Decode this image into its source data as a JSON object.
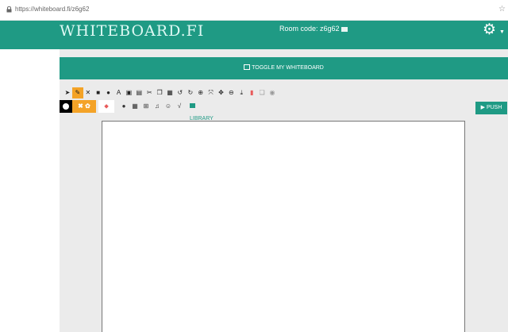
{
  "browser": {
    "url": "https://whiteboard.fi/z6g62"
  },
  "header": {
    "logo_text": "WHITEBOARD.FI",
    "room_label": "Room code: z6g62"
  },
  "toolbar": {
    "toggle_label": "TOGGLE MY WHITEBOARD",
    "push_label": "PUSH",
    "library_label": "LIBRARY",
    "row1_icons": [
      {
        "name": "pointer-icon",
        "glyph": "➤"
      },
      {
        "name": "pencil-icon",
        "glyph": "✎"
      },
      {
        "name": "line-tool-icon",
        "glyph": "✕"
      },
      {
        "name": "rectangle-icon",
        "glyph": "■"
      },
      {
        "name": "circle-icon",
        "glyph": "●"
      },
      {
        "name": "text-icon",
        "glyph": "A"
      },
      {
        "name": "image-icon",
        "glyph": "▣"
      },
      {
        "name": "document-icon",
        "glyph": "▤"
      },
      {
        "name": "cut-icon",
        "glyph": "✂"
      },
      {
        "name": "copy-icon",
        "glyph": "❐"
      },
      {
        "name": "paste-icon",
        "glyph": "▦"
      },
      {
        "name": "undo-icon",
        "glyph": "↺"
      },
      {
        "name": "redo-icon",
        "glyph": "↻"
      },
      {
        "name": "zoom-icon",
        "glyph": "⊕"
      },
      {
        "name": "fit-icon",
        "glyph": "⤧"
      },
      {
        "name": "move-icon",
        "glyph": "✥"
      },
      {
        "name": "zoom-out-icon",
        "glyph": "⊖"
      },
      {
        "name": "download-icon",
        "glyph": "⤓"
      },
      {
        "name": "delete-icon",
        "glyph": "▮"
      },
      {
        "name": "layer-icon",
        "glyph": "❏"
      },
      {
        "name": "eye-icon",
        "glyph": "◉"
      }
    ],
    "row2_icons": [
      {
        "name": "bucket-icon",
        "glyph": "●"
      },
      {
        "name": "grid-icon",
        "glyph": "▦"
      },
      {
        "name": "table-icon",
        "glyph": "⊞"
      },
      {
        "name": "music-icon",
        "glyph": "♫"
      },
      {
        "name": "emoji-icon",
        "glyph": "☺"
      },
      {
        "name": "math-icon",
        "glyph": "√"
      }
    ]
  }
}
